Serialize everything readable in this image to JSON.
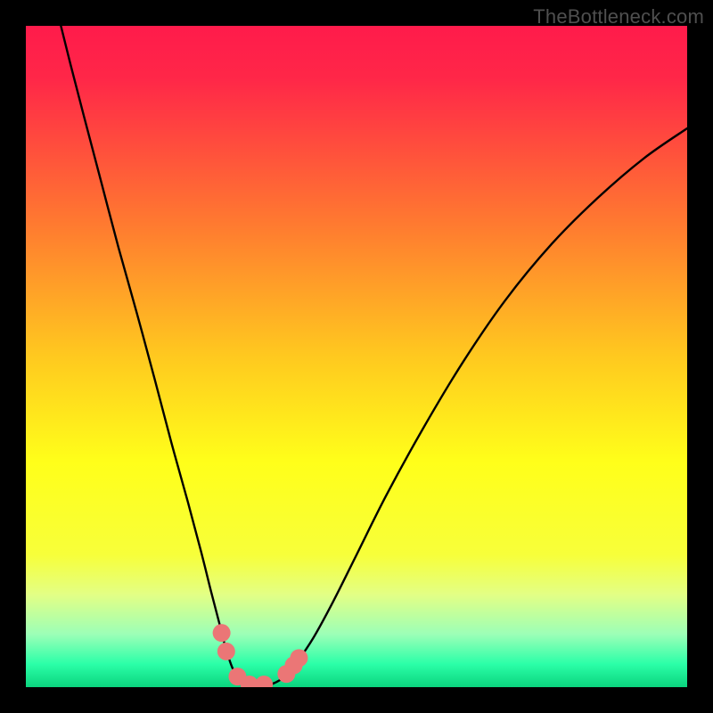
{
  "watermark": "TheBottleneck.com",
  "chart_data": {
    "type": "line",
    "title": "",
    "xlabel": "",
    "ylabel": "",
    "xlim": [
      0,
      1
    ],
    "ylim": [
      0,
      1
    ],
    "gradient_stops": [
      {
        "offset": 0.0,
        "color": "#ff1b4b"
      },
      {
        "offset": 0.08,
        "color": "#ff2748"
      },
      {
        "offset": 0.3,
        "color": "#ff7a30"
      },
      {
        "offset": 0.5,
        "color": "#ffc91f"
      },
      {
        "offset": 0.66,
        "color": "#ffff1a"
      },
      {
        "offset": 0.8,
        "color": "#f7ff3a"
      },
      {
        "offset": 0.86,
        "color": "#e3ff85"
      },
      {
        "offset": 0.92,
        "color": "#9cffb7"
      },
      {
        "offset": 0.965,
        "color": "#2bffa8"
      },
      {
        "offset": 1.0,
        "color": "#0bd47e"
      }
    ],
    "series": [
      {
        "name": "left-curve",
        "points": [
          {
            "x": 0.053,
            "y": 1.0
          },
          {
            "x": 0.068,
            "y": 0.94
          },
          {
            "x": 0.09,
            "y": 0.855
          },
          {
            "x": 0.115,
            "y": 0.76
          },
          {
            "x": 0.14,
            "y": 0.665
          },
          {
            "x": 0.168,
            "y": 0.565
          },
          {
            "x": 0.195,
            "y": 0.465
          },
          {
            "x": 0.22,
            "y": 0.37
          },
          {
            "x": 0.245,
            "y": 0.28
          },
          {
            "x": 0.265,
            "y": 0.205
          },
          {
            "x": 0.28,
            "y": 0.145
          },
          {
            "x": 0.293,
            "y": 0.095
          },
          {
            "x": 0.302,
            "y": 0.06
          },
          {
            "x": 0.312,
            "y": 0.03
          },
          {
            "x": 0.322,
            "y": 0.012
          },
          {
            "x": 0.335,
            "y": 0.004
          },
          {
            "x": 0.35,
            "y": 0.002
          }
        ]
      },
      {
        "name": "right-curve",
        "points": [
          {
            "x": 0.35,
            "y": 0.002
          },
          {
            "x": 0.37,
            "y": 0.004
          },
          {
            "x": 0.39,
            "y": 0.015
          },
          {
            "x": 0.41,
            "y": 0.038
          },
          {
            "x": 0.435,
            "y": 0.075
          },
          {
            "x": 0.465,
            "y": 0.13
          },
          {
            "x": 0.5,
            "y": 0.2
          },
          {
            "x": 0.545,
            "y": 0.29
          },
          {
            "x": 0.6,
            "y": 0.39
          },
          {
            "x": 0.66,
            "y": 0.49
          },
          {
            "x": 0.725,
            "y": 0.585
          },
          {
            "x": 0.795,
            "y": 0.67
          },
          {
            "x": 0.865,
            "y": 0.74
          },
          {
            "x": 0.935,
            "y": 0.8
          },
          {
            "x": 1.0,
            "y": 0.845
          }
        ]
      }
    ],
    "markers": [
      {
        "x": 0.296,
        "y": 0.082
      },
      {
        "x": 0.303,
        "y": 0.054
      },
      {
        "x": 0.32,
        "y": 0.016
      },
      {
        "x": 0.338,
        "y": 0.004
      },
      {
        "x": 0.36,
        "y": 0.004
      },
      {
        "x": 0.394,
        "y": 0.02
      },
      {
        "x": 0.405,
        "y": 0.033
      },
      {
        "x": 0.413,
        "y": 0.044
      }
    ],
    "marker_color": "#eb7676",
    "marker_radius_px": 10
  }
}
